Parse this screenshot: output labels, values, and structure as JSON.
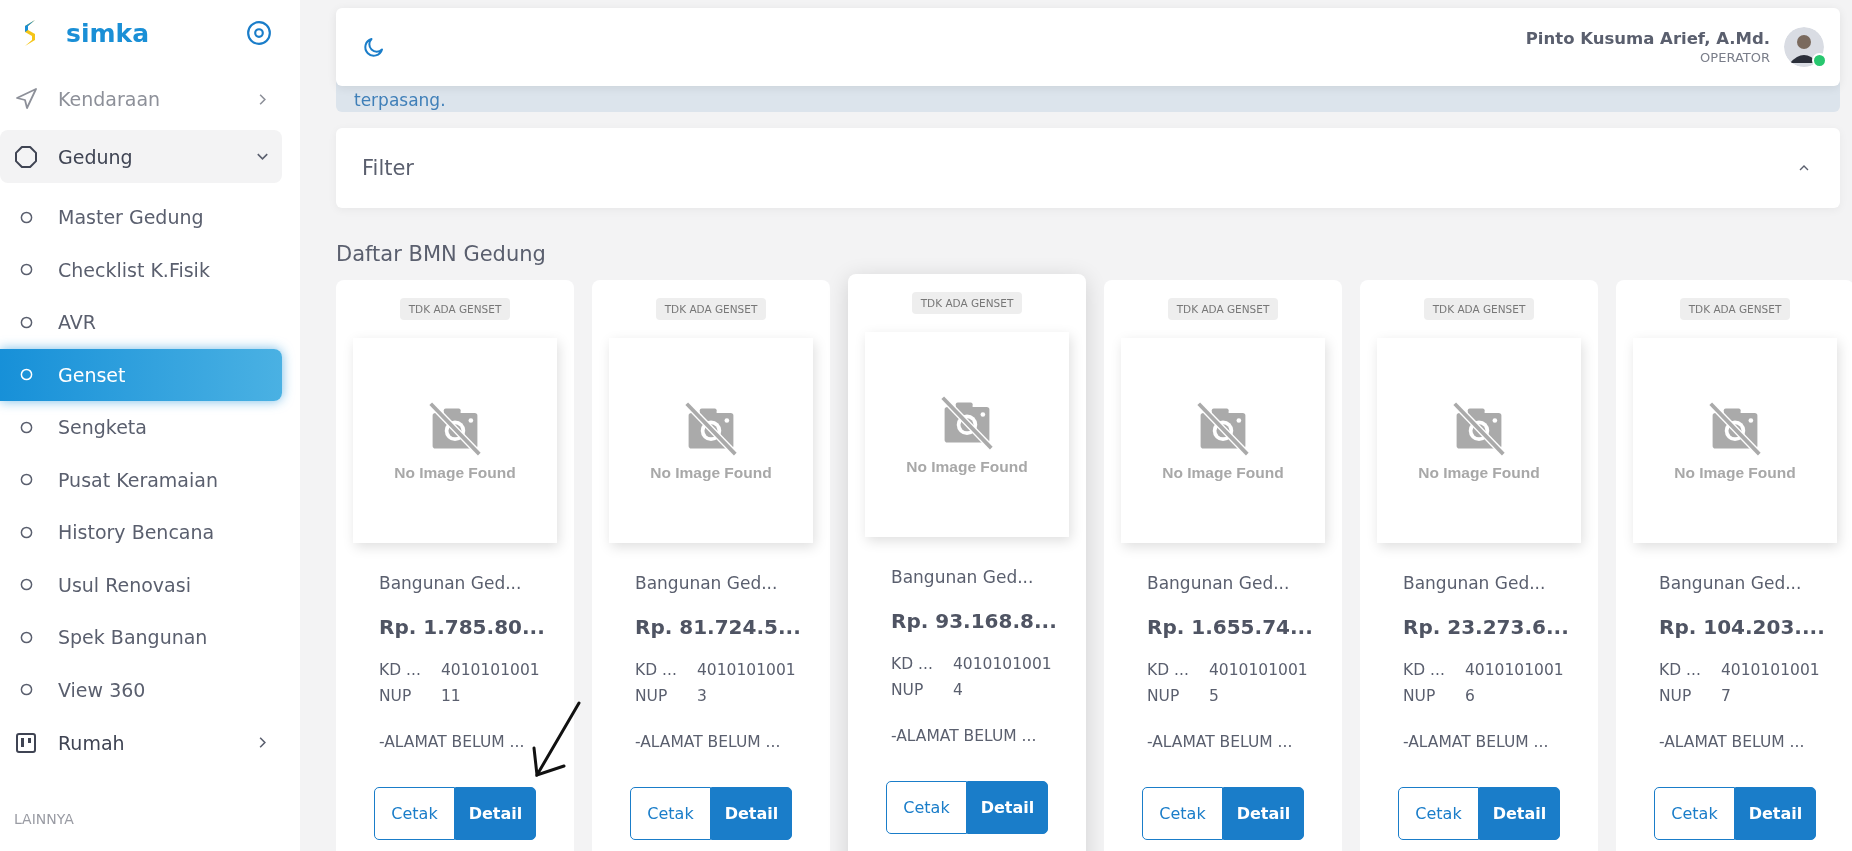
{
  "sidebar": {
    "brand": "simka",
    "menu": [
      {
        "label": "Kendaraan",
        "expanded": false,
        "selected": false
      },
      {
        "label": "Gedung",
        "expanded": true,
        "selected": false,
        "children": [
          {
            "label": "Master Gedung",
            "selected": false
          },
          {
            "label": "Checklist K.Fisik",
            "selected": false
          },
          {
            "label": "AVR",
            "selected": false
          },
          {
            "label": "Genset",
            "selected": true
          },
          {
            "label": "Sengketa",
            "selected": false
          },
          {
            "label": "Pusat Keramaian",
            "selected": false
          },
          {
            "label": "History Bencana",
            "selected": false
          },
          {
            "label": "Usul Renovasi",
            "selected": false
          },
          {
            "label": "Spek Bangunan",
            "selected": false
          },
          {
            "label": "View 360",
            "selected": false
          }
        ]
      },
      {
        "label": "Rumah",
        "expanded": false,
        "selected": false
      }
    ],
    "section_label": "LAINNYA"
  },
  "header": {
    "user_name": "Pinto Kusuma Arief, A.Md.",
    "user_role": "OPERATOR",
    "online": true
  },
  "alert": {
    "text": "terpasang."
  },
  "filter": {
    "title": "Filter",
    "expanded": true
  },
  "list": {
    "title": "Daftar BMN Gedung",
    "cards": [
      {
        "badge": "TDK ADA GENSET",
        "image_text": "No Image Found",
        "name": "Bangunan Ged...",
        "price": "Rp. 1.785.80...",
        "kd_label": "KD ...",
        "kd": "4010101001",
        "nup_label": "NUP",
        "nup": "11",
        "address": "-ALAMAT BELUM ...",
        "raised": false,
        "buttons": [
          "Cetak",
          "Detail"
        ]
      },
      {
        "badge": "TDK ADA GENSET",
        "image_text": "No Image Found",
        "name": "Bangunan Ged...",
        "price": "Rp. 81.724.5...",
        "kd_label": "KD ...",
        "kd": "4010101001",
        "nup_label": "NUP",
        "nup": "3",
        "address": "-ALAMAT BELUM ...",
        "raised": false,
        "buttons": [
          "Cetak",
          "Detail"
        ]
      },
      {
        "badge": "TDK ADA GENSET",
        "image_text": "No Image Found",
        "name": "Bangunan Ged...",
        "price": "Rp. 93.168.8...",
        "kd_label": "KD ...",
        "kd": "4010101001",
        "nup_label": "NUP",
        "nup": "4",
        "address": "-ALAMAT BELUM ...",
        "raised": true,
        "buttons": [
          "Cetak",
          "Detail"
        ]
      },
      {
        "badge": "TDK ADA GENSET",
        "image_text": "No Image Found",
        "name": "Bangunan Ged...",
        "price": "Rp. 1.655.74...",
        "kd_label": "KD ...",
        "kd": "4010101001",
        "nup_label": "NUP",
        "nup": "5",
        "address": "-ALAMAT BELUM ...",
        "raised": false,
        "buttons": [
          "Cetak",
          "Detail"
        ]
      },
      {
        "badge": "TDK ADA GENSET",
        "image_text": "No Image Found",
        "name": "Bangunan Ged...",
        "price": "Rp. 23.273.6...",
        "kd_label": "KD ...",
        "kd": "4010101001",
        "nup_label": "NUP",
        "nup": "6",
        "address": "-ALAMAT BELUM ...",
        "raised": false,
        "buttons": [
          "Cetak",
          "Detail"
        ]
      },
      {
        "badge": "TDK ADA GENSET",
        "image_text": "No Image Found",
        "name": "Bangunan Ged...",
        "price": "Rp. 104.203....",
        "kd_label": "KD ...",
        "kd": "4010101001",
        "nup_label": "NUP",
        "nup": "7",
        "address": "-ALAMAT BELUM ...",
        "raised": false,
        "buttons": [
          "Cetak",
          "Detail"
        ]
      }
    ]
  }
}
